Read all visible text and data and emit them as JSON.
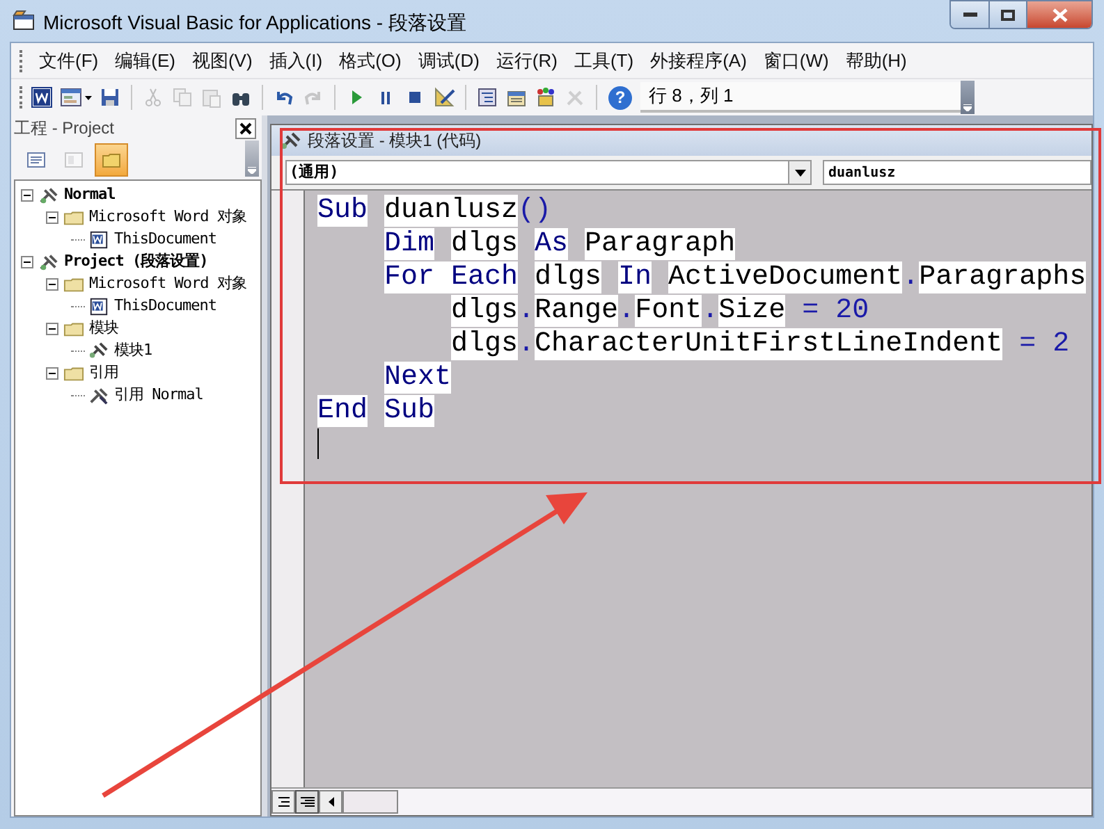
{
  "window": {
    "title": "Microsoft Visual Basic for Applications - 段落设置"
  },
  "menu": [
    {
      "label": "文件(F)"
    },
    {
      "label": "编辑(E)"
    },
    {
      "label": "视图(V)"
    },
    {
      "label": "插入(I)"
    },
    {
      "label": "格式(O)"
    },
    {
      "label": "调试(D)"
    },
    {
      "label": "运行(R)"
    },
    {
      "label": "工具(T)"
    },
    {
      "label": "外接程序(A)"
    },
    {
      "label": "窗口(W)"
    },
    {
      "label": "帮助(H)"
    }
  ],
  "toolbar": {
    "buttons": [
      {
        "kind": "word",
        "disabled": false
      },
      {
        "kind": "form",
        "disabled": false
      },
      {
        "kind": "save",
        "disabled": false
      },
      {
        "kind": "sep"
      },
      {
        "kind": "cut",
        "disabled": true
      },
      {
        "kind": "copy",
        "disabled": true
      },
      {
        "kind": "paste",
        "disabled": true
      },
      {
        "kind": "find",
        "disabled": false
      },
      {
        "kind": "sep"
      },
      {
        "kind": "undo",
        "disabled": false
      },
      {
        "kind": "redo",
        "disabled": true
      },
      {
        "kind": "sep"
      },
      {
        "kind": "run",
        "disabled": false
      },
      {
        "kind": "pause",
        "disabled": false
      },
      {
        "kind": "stop",
        "disabled": false
      },
      {
        "kind": "design",
        "disabled": false
      },
      {
        "kind": "sep"
      },
      {
        "kind": "explorer",
        "disabled": false
      },
      {
        "kind": "properties",
        "disabled": false
      },
      {
        "kind": "browser",
        "disabled": false
      },
      {
        "kind": "toolbox",
        "disabled": true
      },
      {
        "kind": "sep"
      },
      {
        "kind": "help",
        "disabled": false,
        "label": "?"
      }
    ],
    "position": "行 8，列 1"
  },
  "project_panel": {
    "title": "工程 - Project",
    "buttons": [
      {
        "kind": "code",
        "selected": false,
        "disabled": false
      },
      {
        "kind": "object",
        "selected": false,
        "disabled": true
      },
      {
        "kind": "folders",
        "selected": true,
        "disabled": false
      }
    ],
    "tree": [
      {
        "label": "Normal",
        "kind": "project",
        "expanded": true,
        "children": [
          {
            "label": "Microsoft Word 对象",
            "kind": "folder",
            "expanded": true,
            "children": [
              {
                "label": "ThisDocument",
                "kind": "document"
              }
            ]
          }
        ]
      },
      {
        "label": "Project (段落设置)",
        "kind": "project",
        "expanded": true,
        "children": [
          {
            "label": "Microsoft Word 对象",
            "kind": "folder",
            "expanded": true,
            "children": [
              {
                "label": "ThisDocument",
                "kind": "document"
              }
            ]
          },
          {
            "label": "模块",
            "kind": "folder",
            "expanded": true,
            "children": [
              {
                "label": "模块1",
                "kind": "module"
              }
            ]
          },
          {
            "label": "引用",
            "kind": "folder",
            "expanded": true,
            "children": [
              {
                "label": "引用 Normal",
                "kind": "reference"
              }
            ]
          }
        ]
      }
    ]
  },
  "code_window": {
    "title": "段落设置 - 模块1 (代码)",
    "object": "(通用)",
    "procedure": "duanlusz",
    "lines": [
      {
        "kind": "outer",
        "tokens": [
          {
            "text": "Sub",
            "kind": "keyword"
          },
          {
            "text": "duanlusz",
            "kind": "name"
          },
          {
            "text": "()",
            "kind": "punct"
          }
        ]
      },
      {
        "kind": "body",
        "tokens": [
          {
            "text": "Dim",
            "kind": "keyword"
          },
          {
            "text": "dlgs",
            "kind": "name"
          },
          {
            "text": "As",
            "kind": "keyword"
          },
          {
            "text": "Paragraph",
            "kind": "name"
          }
        ]
      },
      {
        "kind": "body",
        "tokens": [
          {
            "text": "For Each",
            "kind": "keyword"
          },
          {
            "text": "dlgs",
            "kind": "name"
          },
          {
            "text": "In",
            "kind": "keyword"
          },
          {
            "text": "ActiveDocument",
            "kind": "name"
          },
          {
            "text": ".",
            "kind": "punct"
          },
          {
            "text": "Paragraphs",
            "kind": "name"
          }
        ]
      },
      {
        "kind": "nested",
        "tokens": [
          {
            "text": "dlgs",
            "kind": "name"
          },
          {
            "text": ".",
            "kind": "punct"
          },
          {
            "text": "Range",
            "kind": "name"
          },
          {
            "text": ".",
            "kind": "punct"
          },
          {
            "text": "Font",
            "kind": "name"
          },
          {
            "text": ".",
            "kind": "punct"
          },
          {
            "text": "Size",
            "kind": "name"
          },
          {
            "text": "= 20",
            "kind": "operator"
          }
        ]
      },
      {
        "kind": "nested",
        "tokens": [
          {
            "text": "dlgs",
            "kind": "name"
          },
          {
            "text": ".",
            "kind": "punct"
          },
          {
            "text": "CharacterUnitFirstLineIndent",
            "kind": "name"
          },
          {
            "text": "= 2",
            "kind": "operator"
          }
        ]
      },
      {
        "kind": "body",
        "tokens": [
          {
            "text": "Next",
            "kind": "keyword"
          }
        ]
      },
      {
        "kind": "outer",
        "tokens": [
          {
            "text": "End",
            "kind": "keyword"
          },
          {
            "text": "Sub",
            "kind": "keyword"
          }
        ]
      }
    ]
  }
}
